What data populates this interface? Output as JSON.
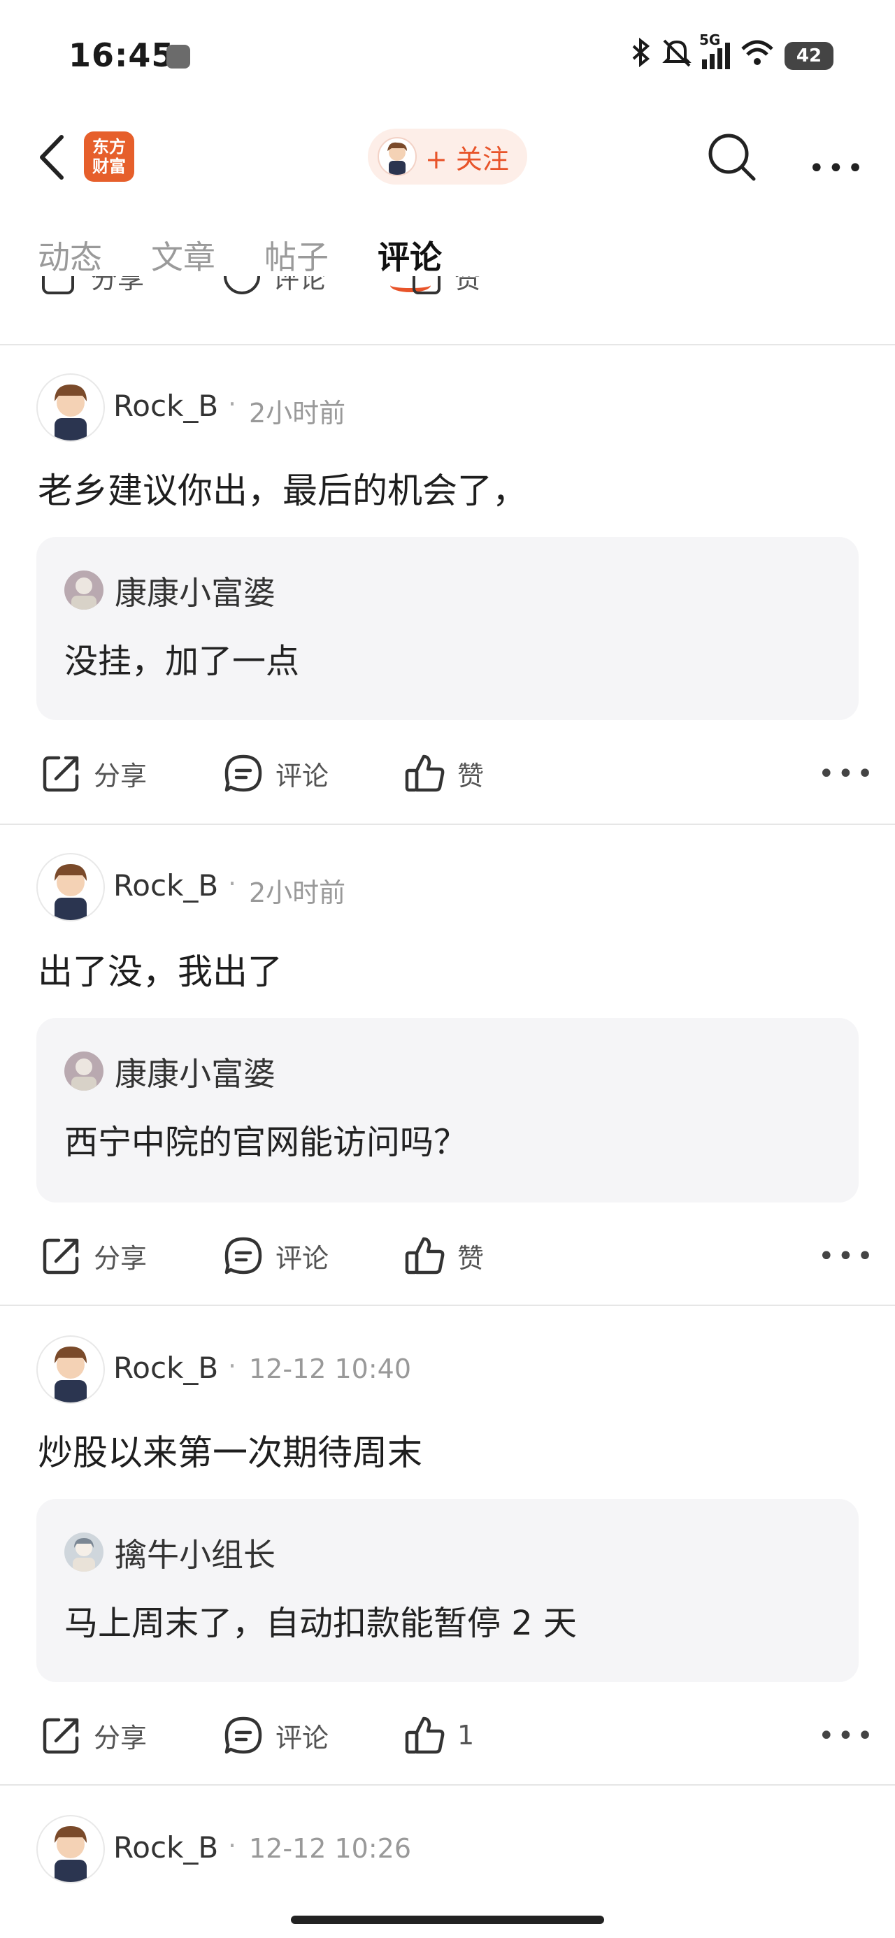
{
  "status": {
    "time": "16:45",
    "network": "5G",
    "battery": "42"
  },
  "header": {
    "logo_line1": "东方",
    "logo_line2": "财富",
    "follow_label": "+ 关注"
  },
  "tabs": [
    {
      "label": "动态",
      "active": false
    },
    {
      "label": "文章",
      "active": false
    },
    {
      "label": "帖子",
      "active": false
    },
    {
      "label": "评论",
      "active": true
    }
  ],
  "actions": {
    "share": "分享",
    "comment": "评论",
    "like": "赞"
  },
  "comments": [
    {
      "user": "Rock_B",
      "time": "2小时前",
      "text": "老乡建议你出，最后的机会了，",
      "quote": {
        "user": "康康小富婆",
        "text": "没挂，加了一点"
      },
      "like_label": "赞"
    },
    {
      "user": "Rock_B",
      "time": "2小时前",
      "text": "出了没，我出了",
      "quote": {
        "user": "康康小富婆",
        "text": "西宁中院的官网能访问吗？"
      },
      "like_label": "赞"
    },
    {
      "user": "Rock_B",
      "time": "12-12 10:40",
      "text": "炒股以来第一次期待周末",
      "quote": {
        "user": "擒牛小组长",
        "text": "马上周末了，自动扣款能暂停 2 天"
      },
      "like_label": "1"
    },
    {
      "user": "Rock_B",
      "time": "12-12 10:26"
    }
  ],
  "colors": {
    "accent": "#e8542a",
    "quote_bg": "#f5f5f7",
    "divider": "#e6e6e6"
  }
}
